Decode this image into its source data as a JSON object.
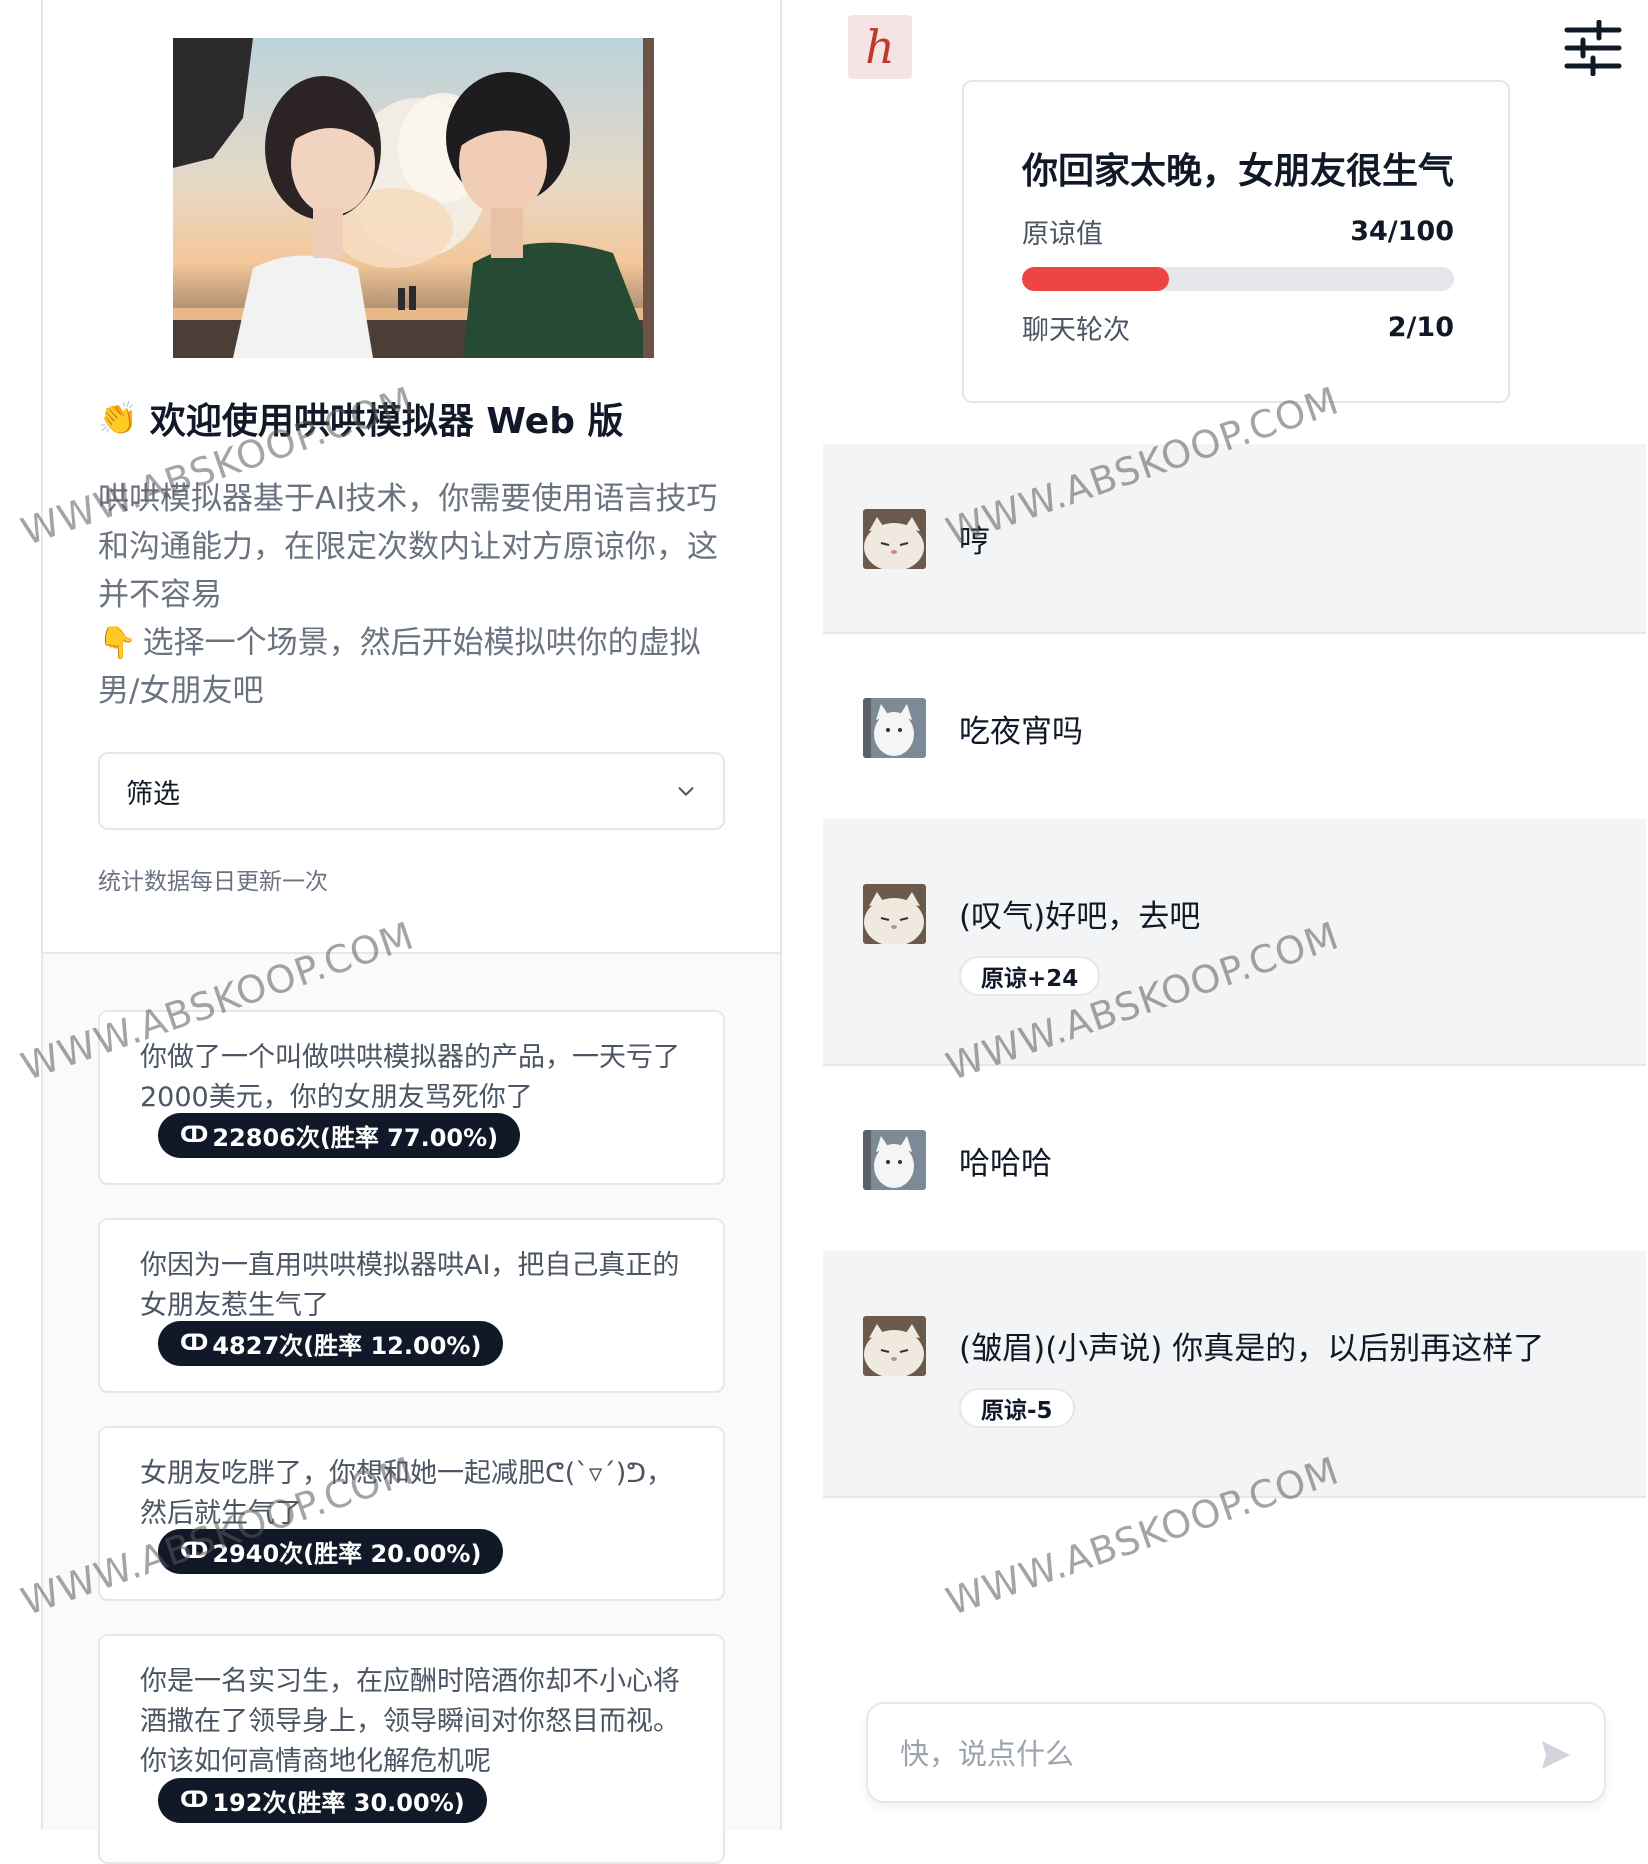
{
  "intro": {
    "title": "欢迎使用哄哄模拟器 Web 版",
    "description_1": "哄哄模拟器基于AI技术，你需要使用语言技巧和沟通能力，在限定次数内让对方原谅你，这并不容易",
    "description_2": "选择一个场景，然后开始模拟哄你的虚拟男/女朋友吧",
    "wave_icon": "👏",
    "point_icon": "👇"
  },
  "filter": {
    "label": "筛选"
  },
  "stats_note": "统计数据每日更新一次",
  "scenarios": [
    {
      "text": "你做了一个叫做哄哄模拟器的产品，一天亏了2000美元，你的女朋友骂死你了",
      "badge": "22806次(胜率 77.00%)"
    },
    {
      "text": "你因为一直用哄哄模拟器哄AI，把自己真正的女朋友惹生气了",
      "badge": "4827次(胜率 12.00%)"
    },
    {
      "text": "女朋友吃胖了，你想和她一起减肥ᕦ(`▿´)ᕤ，然后就生气了",
      "badge": "2940次(胜率 20.00%)"
    },
    {
      "text": "你是一名实习生，在应酬时陪酒你却不小心将酒撒在了领导身上，领导瞬间对你怒目而视。你该如何高情商地化解危机呢",
      "badge": "192次(胜率 30.00%)"
    }
  ],
  "status": {
    "title": "你回家太晚，女朋友很生气",
    "forgiveness_label": "原谅值",
    "forgiveness_value": "34/100",
    "forgiveness_progress": 0.34,
    "rounds_label": "聊天轮次",
    "rounds_value": "2/10"
  },
  "messages": [
    {
      "role": "assistant",
      "text": "哼"
    },
    {
      "role": "user",
      "text": "吃夜宵吗"
    },
    {
      "role": "assistant",
      "text": "(叹气)好吧，去吧",
      "score": "原谅+24"
    },
    {
      "role": "user",
      "text": "哈哈哈"
    },
    {
      "role": "assistant",
      "text": "(皱眉)(小声说) 你真是的，以后别再这样了",
      "score": "原谅-5"
    }
  ],
  "chat_input": {
    "placeholder": "快，说点什么"
  },
  "logo_text": "h",
  "watermark": "WWW.ABSKOOP.COM",
  "colors": {
    "accent_red": "#ef4444",
    "badge_dark": "#111827"
  }
}
